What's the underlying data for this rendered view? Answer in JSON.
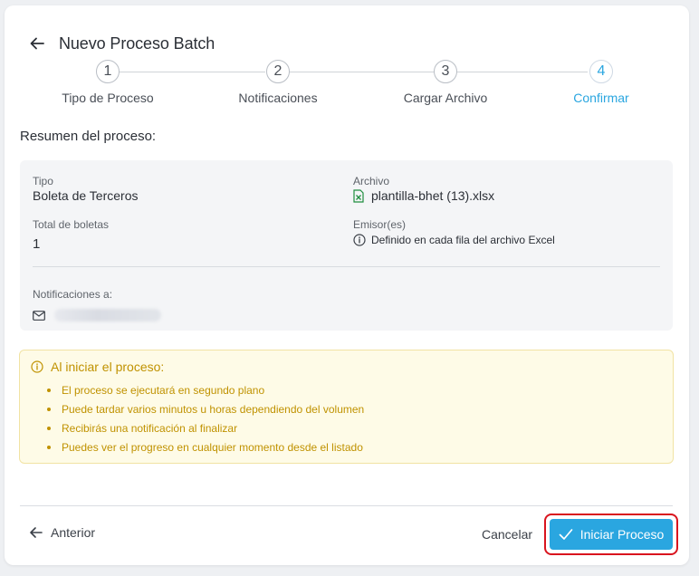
{
  "header": {
    "title": "Nuevo Proceso Batch"
  },
  "stepper": {
    "steps": [
      {
        "number": "1",
        "label": "Tipo de Proceso"
      },
      {
        "number": "2",
        "label": "Notificaciones"
      },
      {
        "number": "3",
        "label": "Cargar Archivo"
      },
      {
        "number": "4",
        "label": "Confirmar"
      }
    ],
    "active_step": 4
  },
  "summary": {
    "section_title": "Resumen del proceso:",
    "tipo_label": "Tipo",
    "tipo_value": "Boleta de Terceros",
    "archivo_label": "Archivo",
    "archivo_value": "plantilla-bhet (13).xlsx",
    "total_label": "Total de boletas",
    "total_value": "1",
    "emisor_label": "Emisor(es)",
    "emisor_value": "Definido en cada fila del archivo Excel",
    "notif_label": "Notificaciones a:"
  },
  "warning": {
    "title": "Al iniciar el proceso:",
    "items": [
      "El proceso se ejecutará en segundo plano",
      "Puede tardar varios minutos u horas dependiendo del volumen",
      "Recibirás una notificación al finalizar",
      "Puedes ver el progreso en cualquier momento desde el listado"
    ]
  },
  "footer": {
    "prev_label": "Anterior",
    "cancel_label": "Cancelar",
    "start_label": "Iniciar Proceso"
  },
  "colors": {
    "accent": "#2aa6e0",
    "warning_text": "#c09200",
    "highlight_border": "#d9141e",
    "excel_green": "#1e8e3e"
  },
  "icons": {
    "back": "arrow-left-icon",
    "file": "excel-file-icon",
    "info": "info-icon",
    "mail": "mail-icon",
    "warning": "info-circle-icon",
    "check": "check-icon"
  }
}
